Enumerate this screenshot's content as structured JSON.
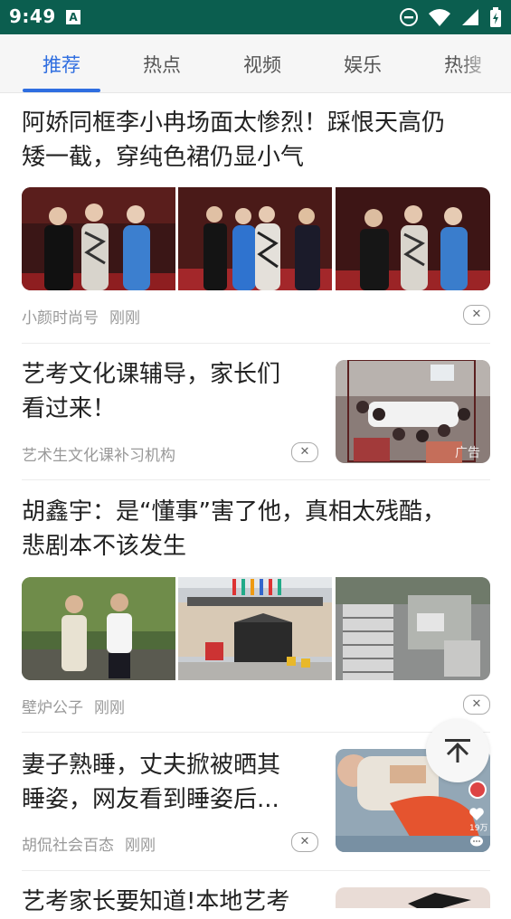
{
  "status_bar": {
    "time": "9:49",
    "notif_icon": "A",
    "icons": [
      "dnd-icon",
      "wifi-icon",
      "signal-icon",
      "battery-icon"
    ]
  },
  "tabs": [
    {
      "label": "推荐",
      "active": true
    },
    {
      "label": "热点",
      "active": false
    },
    {
      "label": "视频",
      "active": false
    },
    {
      "label": "娱乐",
      "active": false
    },
    {
      "label": "热搜",
      "active": false
    }
  ],
  "colors": {
    "accent": "#2f6ee0",
    "status_bar": "#0b5e4f"
  },
  "feed": [
    {
      "title_line1": "阿娇同框李小冉场面太惨烈！踩恨天高仍",
      "title_line2": "矮一截，穿纯色裙仍显小气",
      "source": "小颜时尚号",
      "time": "刚刚",
      "close_glyph": "✕"
    },
    {
      "title_line1": "艺考文化课辅导，家长们",
      "title_line2": "看过来！",
      "source": "艺术生文化课补习机构",
      "ad_label": "广告",
      "close_glyph": "✕"
    },
    {
      "title_line1": "胡鑫宇：是“懂事”害了他，真相太残酷，",
      "title_line2": "悲剧本不该发生",
      "source": "壁炉公子",
      "time": "刚刚",
      "close_glyph": "✕"
    },
    {
      "title_line1": "妻子熟睡，丈夫掀被晒其",
      "title_line2": "睡姿，网友看到睡姿后...",
      "source": "胡侃社会百态",
      "time": "刚刚",
      "close_glyph": "✕",
      "like_count": "19万"
    },
    {
      "title_line1": "艺考家长要知道!本地艺考"
    }
  ],
  "back_to_top": "⤒"
}
